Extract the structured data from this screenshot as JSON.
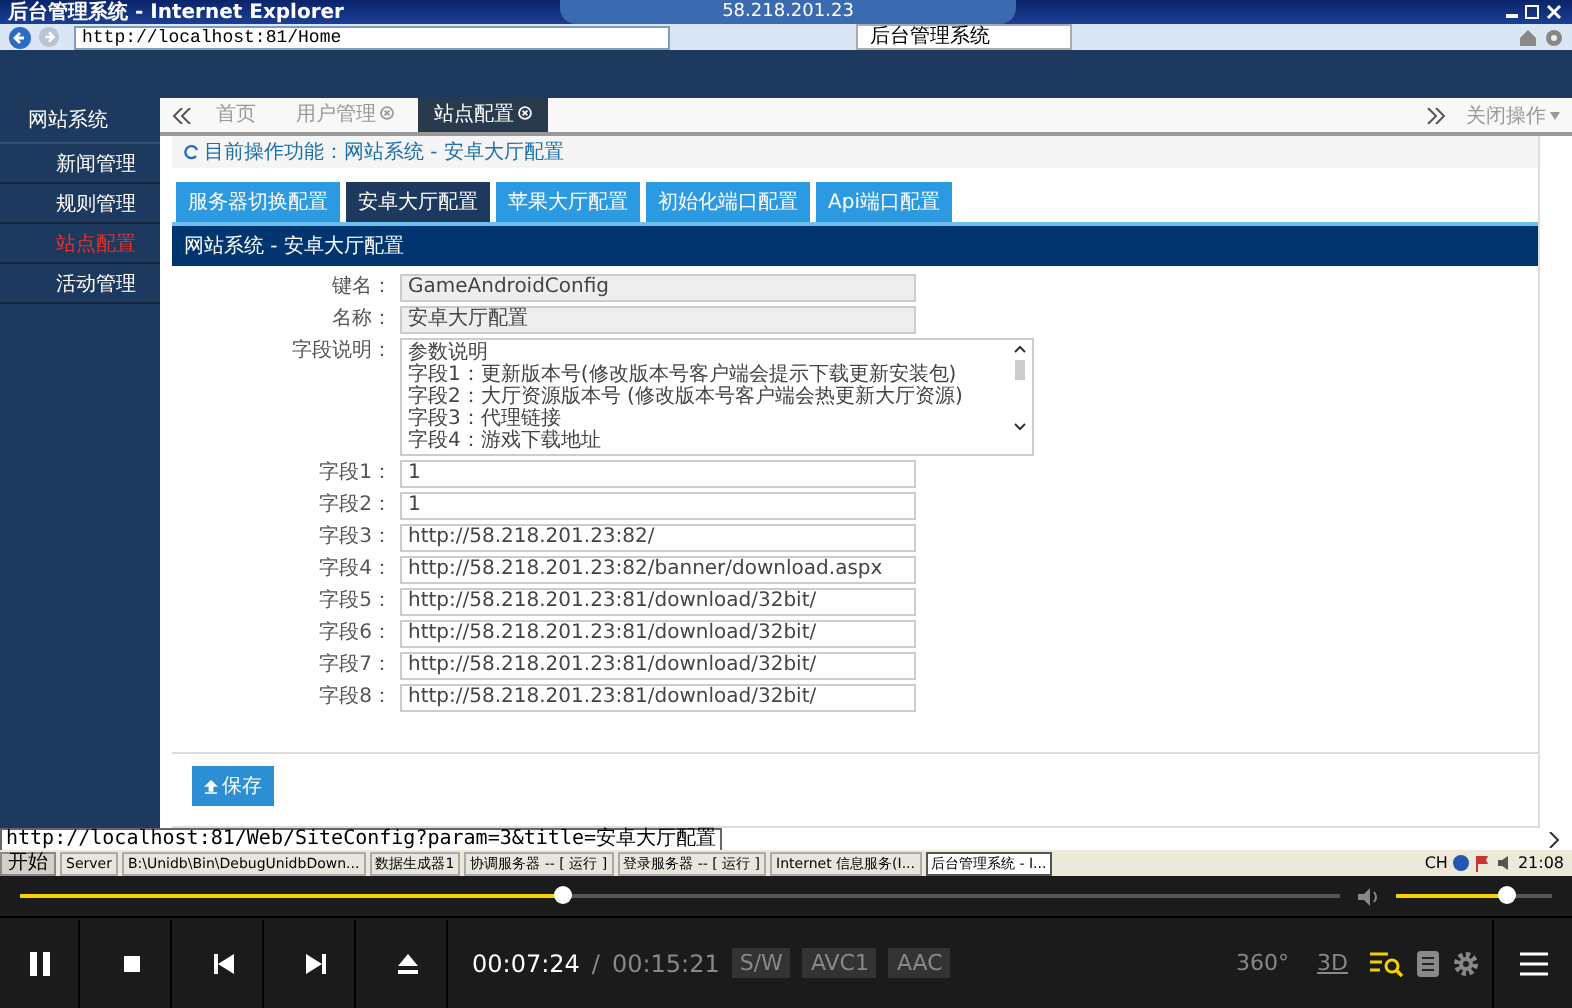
{
  "browser": {
    "title": "后台管理系统 - Internet Explorer",
    "remote_host": "58.218.201.23",
    "address": "http://localhost:81/Home",
    "tab": "后台管理系统"
  },
  "sidebar": {
    "title": "网站系统",
    "items": [
      {
        "label": "新闻管理",
        "selected": false
      },
      {
        "label": "规则管理",
        "selected": false
      },
      {
        "label": "站点配置",
        "selected": true
      },
      {
        "label": "活动管理",
        "selected": false
      }
    ]
  },
  "page_tabs": {
    "items": [
      {
        "label": "首页",
        "selected": false,
        "closable": false
      },
      {
        "label": "用户管理",
        "selected": false,
        "closable": true
      },
      {
        "label": "站点配置",
        "selected": true,
        "closable": true
      }
    ],
    "close_menu": "关闭操作"
  },
  "breadcrumb": {
    "label": "目前操作功能：",
    "path": "网站系统 - 安卓大厅配置"
  },
  "config_tabs": [
    {
      "label": "服务器切换配置",
      "selected": false
    },
    {
      "label": "安卓大厅配置",
      "selected": true
    },
    {
      "label": "苹果大厅配置",
      "selected": false
    },
    {
      "label": "初始化端口配置",
      "selected": false
    },
    {
      "label": "Api端口配置",
      "selected": false
    }
  ],
  "section_title": "网站系统 - 安卓大厅配置",
  "form": [
    {
      "kind": "input",
      "label": "键名：",
      "value": "GameAndroidConfig",
      "readonly": true
    },
    {
      "kind": "input",
      "label": "名称：",
      "value": "安卓大厅配置",
      "readonly": true
    },
    {
      "kind": "textarea",
      "label": "字段说明：",
      "lines": [
        "参数说明",
        "字段1：更新版本号(修改版本号客户端会提示下载更新安装包)",
        "字段2：大厅资源版本号 (修改版本号客户端会热更新大厅资源)",
        "字段3：代理链接",
        "字段4：游戏下载地址"
      ]
    },
    {
      "kind": "input",
      "label": "字段1：",
      "value": "1",
      "readonly": false
    },
    {
      "kind": "input",
      "label": "字段2：",
      "value": "1",
      "readonly": false
    },
    {
      "kind": "input",
      "label": "字段3：",
      "value": "http://58.218.201.23:82/",
      "readonly": false
    },
    {
      "kind": "input",
      "label": "字段4：",
      "value": "http://58.218.201.23:82/banner/download.aspx",
      "readonly": false
    },
    {
      "kind": "input",
      "label": "字段5：",
      "value": "http://58.218.201.23:81/download/32bit/",
      "readonly": false
    },
    {
      "kind": "input",
      "label": "字段6：",
      "value": "http://58.218.201.23:81/download/32bit/",
      "readonly": false
    },
    {
      "kind": "input",
      "label": "字段7：",
      "value": "http://58.218.201.23:81/download/32bit/",
      "readonly": false
    },
    {
      "kind": "input",
      "label": "字段8：",
      "value": "http://58.218.201.23:81/download/32bit/",
      "readonly": false
    }
  ],
  "save_button": "保存",
  "status_url": "http://localhost:81/Web/SiteConfig?param=3&title=安卓大厅配置",
  "taskbar": {
    "start": "开始",
    "items": [
      {
        "label": "Server",
        "selected": false
      },
      {
        "label": "B:\\Unidb\\Bin\\DebugUnidbDown...",
        "selected": false
      },
      {
        "label": "数据生成器1",
        "selected": false
      },
      {
        "label": "协调服务器 -- [ 运行 ]",
        "selected": false
      },
      {
        "label": "登录服务器 -- [ 运行 ]",
        "selected": false
      },
      {
        "label": "Internet 信息服务(I...",
        "selected": false
      },
      {
        "label": "后台管理系统 - I...",
        "selected": true
      }
    ],
    "lang": "CH",
    "clock": "21:08"
  },
  "player": {
    "progress": {
      "level": 0.41
    },
    "volume": {
      "level": 0.7
    },
    "elapsed": "00:07:24",
    "separator": "/",
    "duration": "00:15:21",
    "badges": [
      "S/W",
      "AVC1",
      "AAC"
    ],
    "mode_360": "360°",
    "mode_3d": "3D"
  }
}
